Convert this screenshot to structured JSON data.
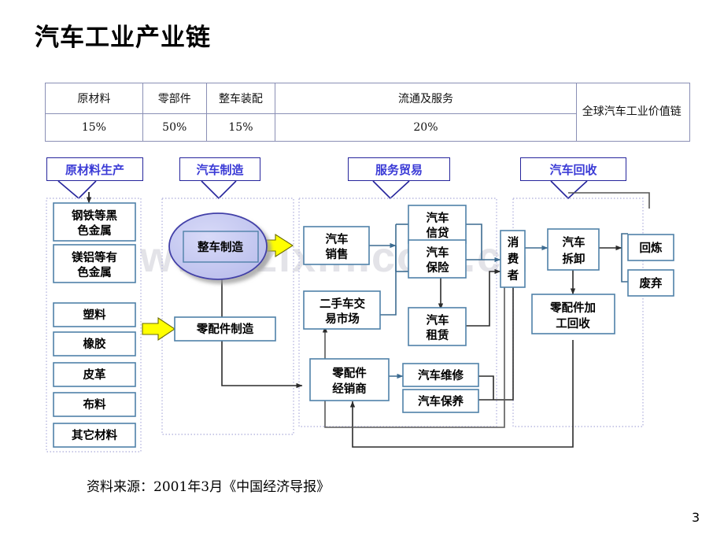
{
  "slide": {
    "title": "汽车工业产业链",
    "page_number": "3",
    "source_note": "资料来源：2001年3月《中国经济导报》",
    "watermark": "www.zixin.com.cn"
  },
  "value_chain_table": {
    "segments": [
      {
        "label": "原材料",
        "share": "15%"
      },
      {
        "label": "零部件",
        "share": "50%"
      },
      {
        "label": "整车装配",
        "share": "15%"
      },
      {
        "label": "流通及服务",
        "share": "20%"
      }
    ],
    "row_label": "全球汽车工业价值链"
  },
  "stage_callouts": [
    {
      "label": "原材料生产"
    },
    {
      "label": "汽车制造"
    },
    {
      "label": "服务贸易"
    },
    {
      "label": "汽车回收"
    }
  ],
  "flow": {
    "raw_materials": [
      "钢铁等黑色金属",
      "镁铝等有色金属",
      "塑料",
      "橡胶",
      "皮革",
      "布料",
      "其它材料"
    ],
    "manufacturing": {
      "assembly": "整车制造",
      "parts_manufacturing": "零配件制造"
    },
    "service_trade": {
      "car_sales": "汽车销售",
      "used_car_market": "二手车交易市场",
      "auto_credit": "汽车信贷",
      "auto_insurance": "汽车保险",
      "auto_leasing": "汽车租赁",
      "parts_dealer": "零配件经销商",
      "auto_repair": "汽车维修",
      "auto_maintenance": "汽车保养",
      "consumer": "消费者"
    },
    "recycling": {
      "dismantling": "汽车拆卸",
      "parts_reprocess": "零配件加工回收",
      "remelting": "回炼",
      "discard": "废弃"
    }
  },
  "colors": {
    "box_border": "#4f81a8",
    "callout_border": "#26259c",
    "callout_text": "#3b3bd6",
    "group_dash": "#b9b9e0",
    "ellipse_fill": "#c5c8f0",
    "ellipse_border": "#4340a8",
    "yellow_arrow": "#ffff00",
    "connector": "#3d6c91",
    "table_border": "#8a8fb5"
  }
}
